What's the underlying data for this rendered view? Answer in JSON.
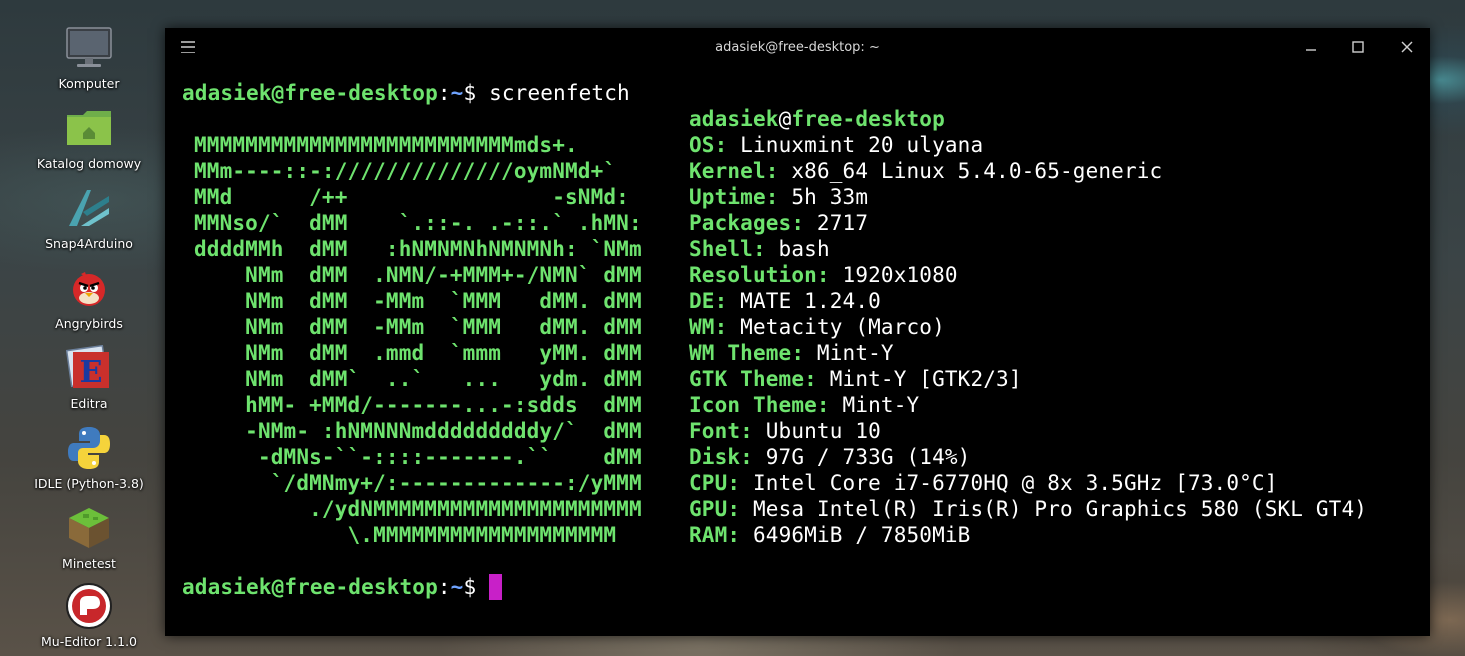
{
  "desktop": {
    "icons": [
      {
        "label": "Komputer",
        "icon": "computer-icon"
      },
      {
        "label": "Katalog domowy",
        "icon": "home-folder-icon"
      },
      {
        "label": "Snap4Arduino",
        "icon": "snap4arduino-icon"
      },
      {
        "label": "Angrybirds",
        "icon": "angrybirds-icon"
      },
      {
        "label": "Editra",
        "icon": "editra-icon"
      },
      {
        "label": "IDLE (Python-3.8)",
        "icon": "python-icon"
      },
      {
        "label": "Minetest",
        "icon": "minetest-icon"
      },
      {
        "label": "Mu-Editor 1.1.0",
        "icon": "mu-editor-icon"
      }
    ]
  },
  "terminal": {
    "title": "adasiek@free-desktop: ~",
    "prompt": {
      "user_host": "adasiek@free-desktop",
      "colon": ":",
      "path": "~",
      "symbol": "$ "
    },
    "command": "screenfetch",
    "colors": {
      "green": "#6ee36e",
      "blue": "#6fa3ff",
      "cursor": "#c820c8",
      "background": "#000000"
    },
    "art": [
      "MMMMMMMMMMMMMMMMMMMMMMMMMmds+.",
      "MMm----::-://////////////oymNMd+`",
      "MMd      /++                -sNMd:",
      "MMNso/`  dMM    `.::-. .-::.` .hMN:",
      "ddddMMh  dMM   :hNMNMNhNMNMNh: `NMm",
      "    NMm  dMM  .NMN/-+MMM+-/NMN` dMM",
      "    NMm  dMM  -MMm  `MMM   dMM. dMM",
      "    NMm  dMM  -MMm  `MMM   dMM. dMM",
      "    NMm  dMM  .mmd  `mmm   yMM. dMM",
      "    NMm  dMM`  ..`   ...   ydm. dMM",
      "    hMM- +MMd/-------...-:sdds  dMM",
      "    -NMm- :hNMNNNmdddddddddy/`  dMM",
      "     -dMNs-``-::::-------.``    dMM",
      "      `/dMNmy+/:-------------:/yMMM",
      "         ./ydNMMMMMMMMMMMMMMMMMMMMM",
      "            \\.MMMMMMMMMMMMMMMMMMM"
    ],
    "info_header": {
      "user": "adasiek",
      "at": "@",
      "host": "free-desktop"
    },
    "info": [
      {
        "key": "OS:",
        "value": " Linuxmint 20 ulyana"
      },
      {
        "key": "Kernel:",
        "value": " x86_64 Linux 5.4.0-65-generic"
      },
      {
        "key": "Uptime:",
        "value": " 5h 33m"
      },
      {
        "key": "Packages:",
        "value": " 2717"
      },
      {
        "key": "Shell:",
        "value": " bash"
      },
      {
        "key": "Resolution:",
        "value": " 1920x1080"
      },
      {
        "key": "DE:",
        "value": " MATE 1.24.0"
      },
      {
        "key": "WM:",
        "value": " Metacity (Marco)"
      },
      {
        "key": "WM Theme:",
        "value": " Mint-Y"
      },
      {
        "key": "GTK Theme:",
        "value": " Mint-Y [GTK2/3]"
      },
      {
        "key": "Icon Theme:",
        "value": " Mint-Y"
      },
      {
        "key": "Font:",
        "value": " Ubuntu 10"
      },
      {
        "key": "Disk:",
        "value": " 97G / 733G (14%)"
      },
      {
        "key": "CPU:",
        "value": " Intel Core i7-6770HQ @ 8x 3.5GHz [73.0°C]"
      },
      {
        "key": "GPU:",
        "value": " Mesa Intel(R) Iris(R) Pro Graphics 580 (SKL GT4)"
      },
      {
        "key": "RAM:",
        "value": " 6496MiB / 7850MiB"
      }
    ]
  }
}
